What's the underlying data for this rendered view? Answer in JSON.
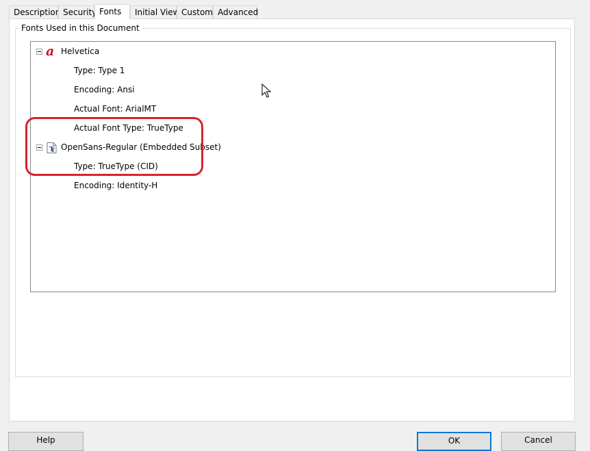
{
  "tabs": [
    {
      "label": "Description"
    },
    {
      "label": "Security"
    },
    {
      "label": "Fonts"
    },
    {
      "label": "Initial View"
    },
    {
      "label": "Custom"
    },
    {
      "label": "Advanced"
    }
  ],
  "active_tab": "Fonts",
  "group": {
    "title": "Fonts Used in this Document"
  },
  "fonts": [
    {
      "name": "Helvetica",
      "icon": "type1-font-icon",
      "properties": [
        "Type: Type 1",
        "Encoding: Ansi",
        "Actual Font: ArialMT",
        "Actual Font Type: TrueType"
      ]
    },
    {
      "name": "OpenSans-Regular (Embedded Subset)",
      "icon": "truetype-font-icon",
      "properties": [
        "Type: TrueType (CID)",
        "Encoding: Identity-H"
      ]
    }
  ],
  "buttons": {
    "help": "Help",
    "ok": "OK",
    "cancel": "Cancel"
  },
  "colors": {
    "annotation": "#d7222e",
    "focus": "#0078d7",
    "type1_icon": "#c8102e"
  }
}
